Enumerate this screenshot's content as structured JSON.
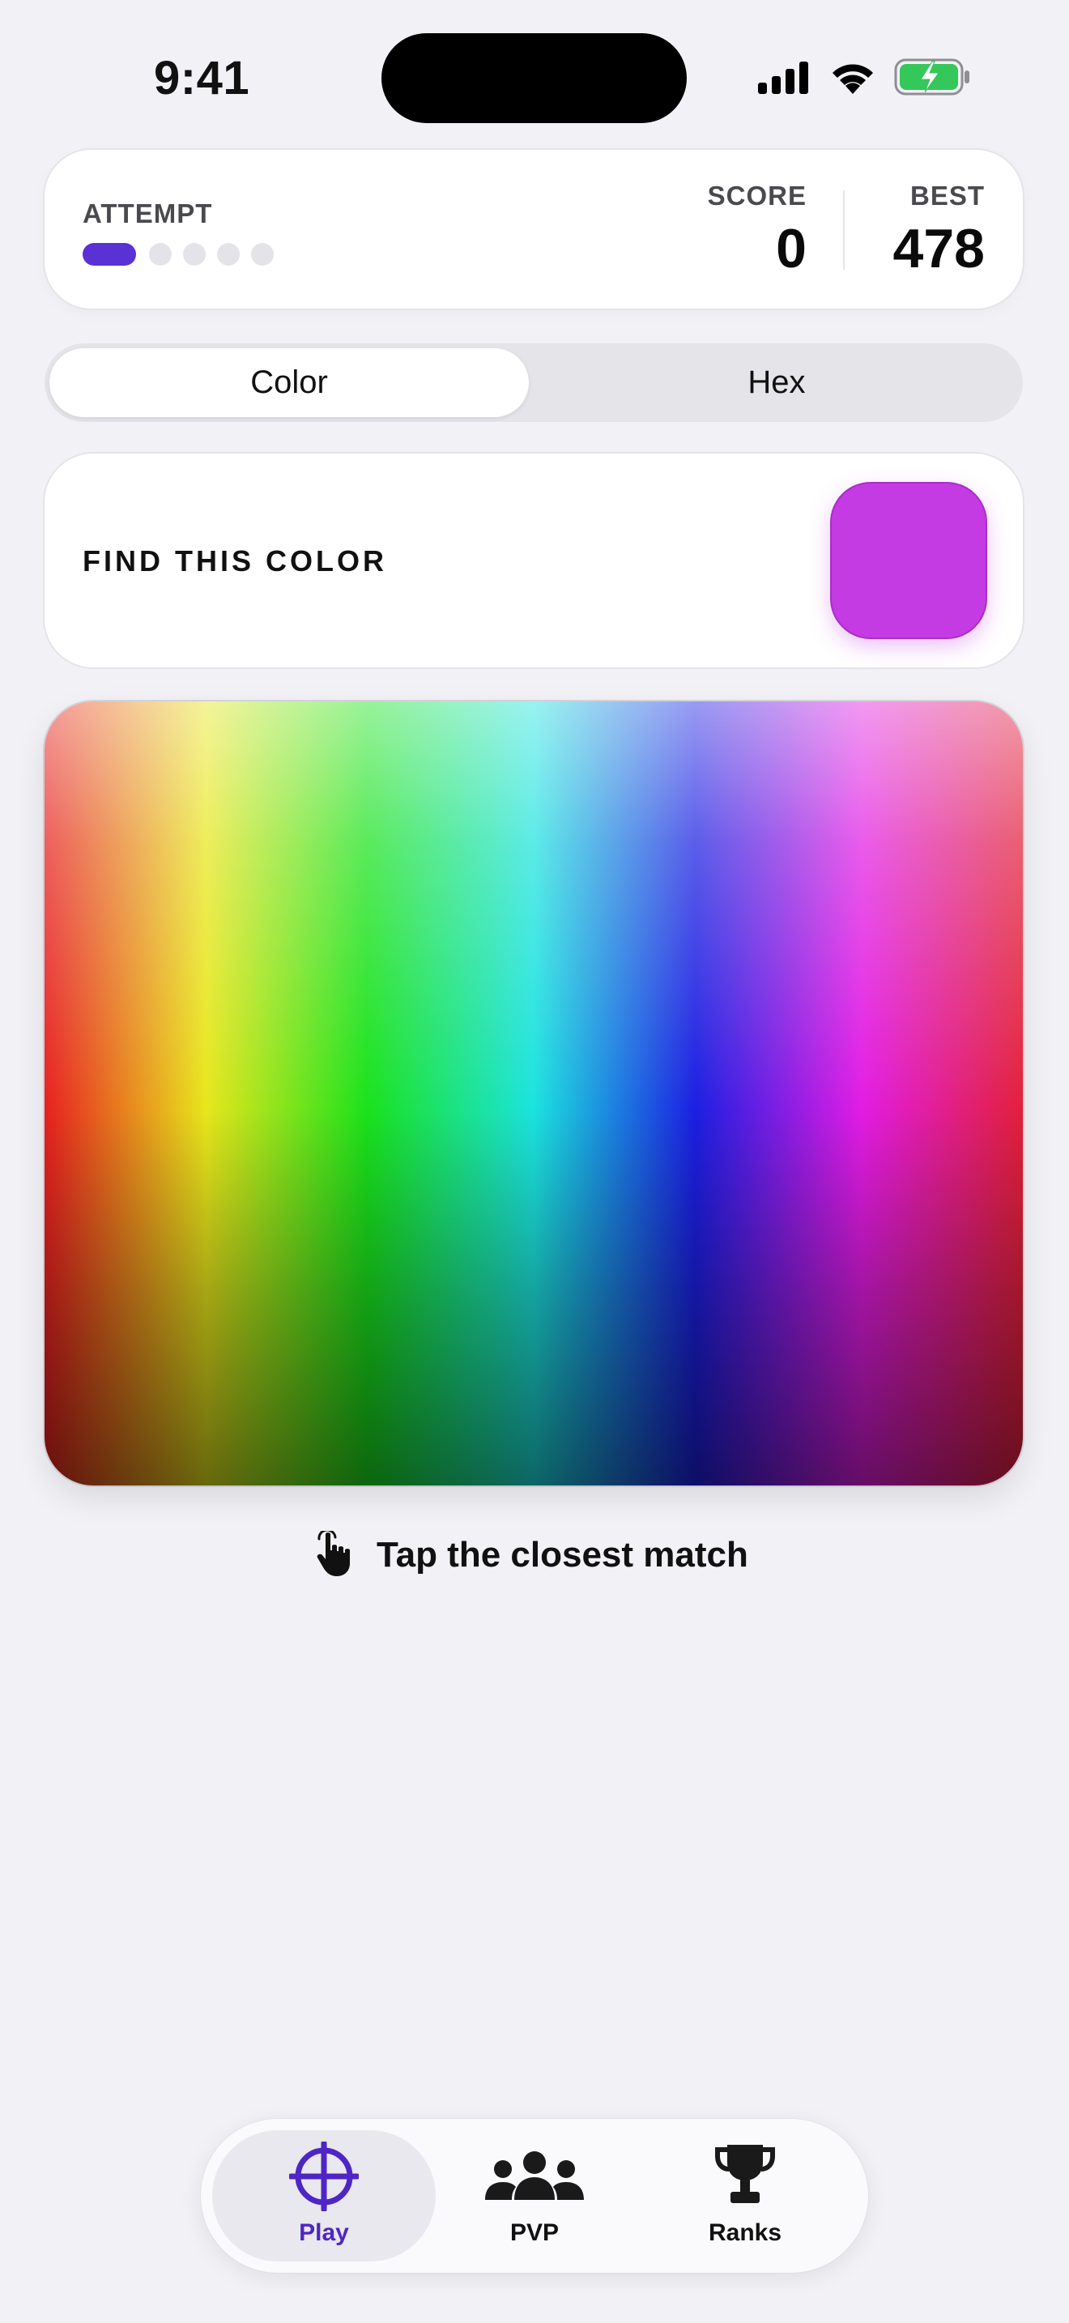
{
  "status_bar": {
    "time": "9:41",
    "icons": [
      "cellular-signal-icon",
      "wifi-icon",
      "battery-charging-icon"
    ]
  },
  "score_card": {
    "attempt_label": "ATTEMPT",
    "attempts_total": 5,
    "current_attempt": 1,
    "score_label": "SCORE",
    "score_value": "0",
    "best_label": "BEST",
    "best_value": "478",
    "accent_color": "#5A31D4"
  },
  "mode_tabs": {
    "options": [
      "Color",
      "Hex"
    ],
    "selected": "Color"
  },
  "target": {
    "label": "FIND THIS COLOR",
    "color": "#C43BE3"
  },
  "color_field": {
    "hues": [
      "#E72020",
      "#E8E61C",
      "#1AE21C",
      "#1CE3DF",
      "#1C1FE2",
      "#E21CE4",
      "#E2203A"
    ]
  },
  "hint": {
    "icon": "pointing-hand-icon",
    "text": "Tap the closest match"
  },
  "tab_bar": {
    "items": [
      {
        "label": "Play",
        "icon": "crosshair-icon",
        "active": true
      },
      {
        "label": "PVP",
        "icon": "people-icon",
        "active": false
      },
      {
        "label": "Ranks",
        "icon": "trophy-icon",
        "active": false
      }
    ],
    "active_color": "#4F25C6"
  }
}
